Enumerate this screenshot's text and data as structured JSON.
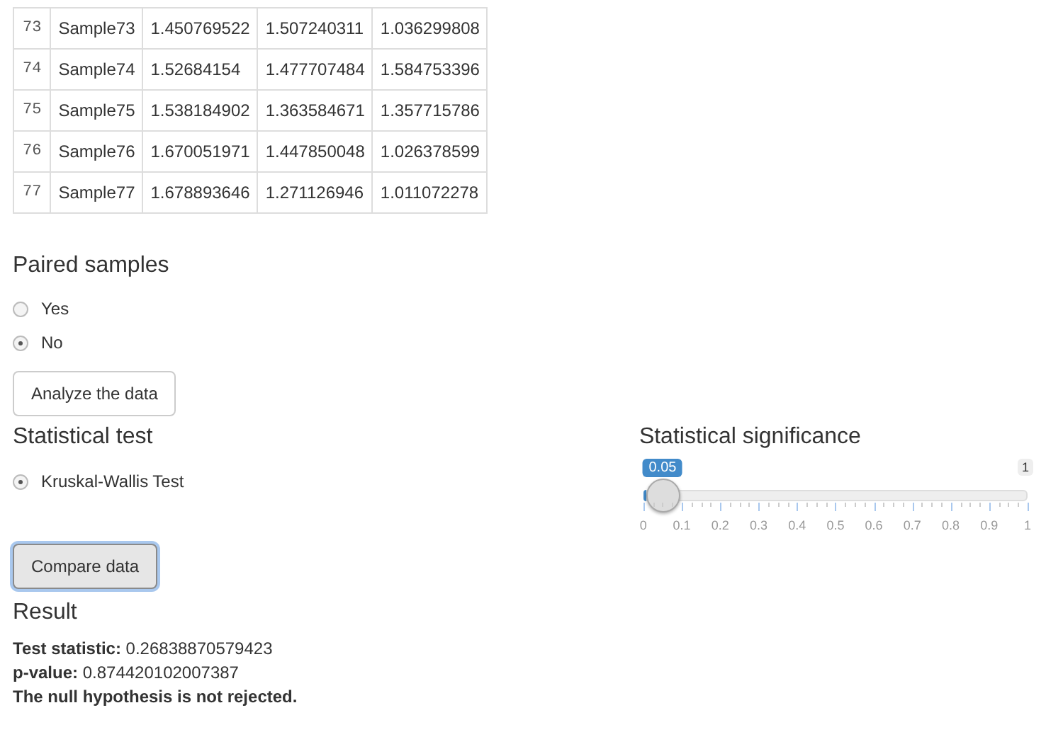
{
  "table": {
    "rows": [
      {
        "index": "73",
        "cells": [
          "Sample73",
          "1.450769522",
          "1.507240311",
          "1.036299808"
        ]
      },
      {
        "index": "74",
        "cells": [
          "Sample74",
          "1.52684154",
          "1.477707484",
          "1.584753396"
        ]
      },
      {
        "index": "75",
        "cells": [
          "Sample75",
          "1.538184902",
          "1.363584671",
          "1.357715786"
        ]
      },
      {
        "index": "76",
        "cells": [
          "Sample76",
          "1.670051971",
          "1.447850048",
          "1.026378599"
        ]
      },
      {
        "index": "77",
        "cells": [
          "Sample77",
          "1.678893646",
          "1.271126946",
          "1.011072278"
        ]
      }
    ]
  },
  "paired": {
    "heading": "Paired samples",
    "options": [
      {
        "label": "Yes",
        "selected": false
      },
      {
        "label": "No",
        "selected": true
      }
    ]
  },
  "analyze_button": "Analyze the data",
  "test": {
    "heading": "Statistical test",
    "options": [
      {
        "label": "Kruskal-Wallis Test",
        "selected": true
      }
    ]
  },
  "significance": {
    "heading": "Statistical significance",
    "value_label": "0.05",
    "max_label": "1",
    "level": 0.05,
    "tick_labels": [
      "0",
      "0.1",
      "0.2",
      "0.3",
      "0.4",
      "0.5",
      "0.6",
      "0.7",
      "0.8",
      "0.9",
      "1"
    ]
  },
  "compare_button": "Compare data",
  "result": {
    "heading": "Result",
    "lines": [
      "**Test statistic:** 0.26838870579423",
      "**p-value:** 0.874420102007387"
    ],
    "conclusion": "The null hypothesis is not rejected."
  }
}
